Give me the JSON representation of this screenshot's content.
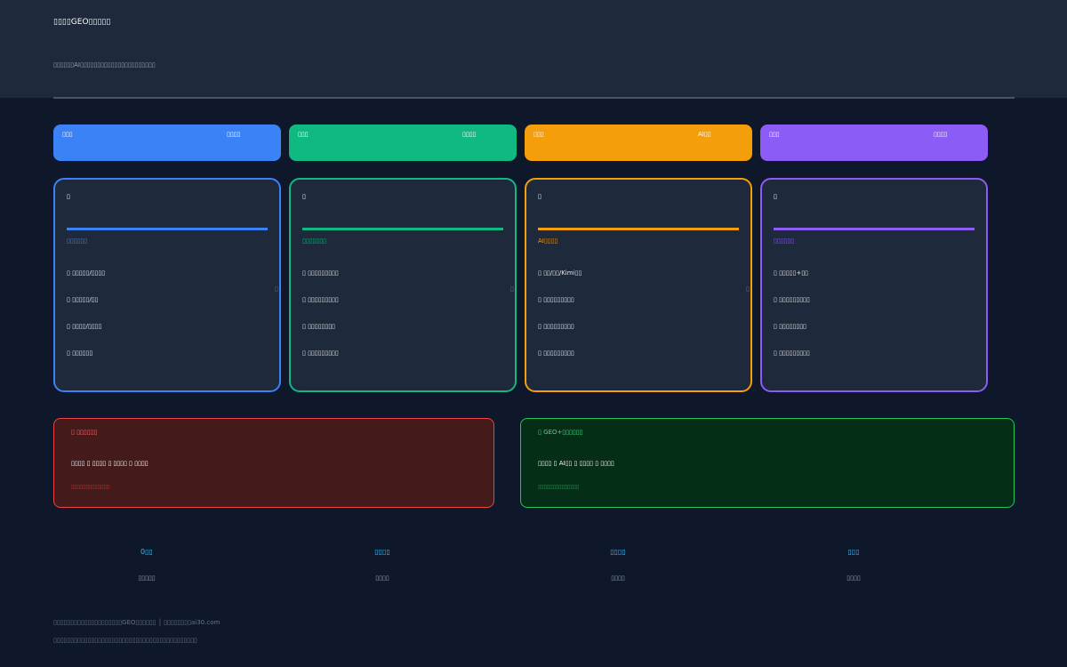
{
  "header": {
    "title": "▯▯▯▯GEO▯▯▯▯▯",
    "subtitle": "▯▯▯▯▯▯AI▯▯▯▯▯▯▯▯▯▯▯▯▯▯▯▯▯▯▯▯▯▯"
  },
  "steps": [
    {
      "num": "▯▯▯",
      "name": "▯▯▯▯",
      "color": "#3b82f6"
    },
    {
      "num": "▯▯▯",
      "name": "▯▯▯▯",
      "color": "#10b981"
    },
    {
      "num": "▯▯▯",
      "name": "AI▯▯",
      "color": "#f59e0b"
    },
    {
      "num": "▯▯▯",
      "name": "▯▯▯▯",
      "color": "#8b5cf6"
    }
  ],
  "cards": [
    {
      "icon": "▯",
      "heading": "▯▯▯▯▯▯",
      "items": [
        "▯ ▯▯▯▯▯/▯▯▯▯",
        "▯ ▯▯▯▯▯/▯▯",
        "▯ ▯▯▯▯/▯▯▯▯",
        "▯ ▯▯▯▯▯▯"
      ]
    },
    {
      "icon": "▯",
      "heading": "▯▯▯▯▯▯▯",
      "items": [
        "▯ ▯▯▯▯▯▯▯▯▯",
        "▯ ▯▯▯▯▯▯▯▯▯",
        "▯ ▯▯▯▯▯▯▯▯",
        "▯ ▯▯▯▯▯▯▯▯▯"
      ]
    },
    {
      "icon": "▯",
      "heading": "AI▯▯▯▯",
      "items": [
        "▯ ▯▯/▯▯/Kimi▯▯",
        "▯ ▯▯▯▯▯▯▯▯▯",
        "▯ ▯▯▯▯▯▯▯▯▯",
        "▯ ▯▯▯▯▯▯▯▯▯"
      ]
    },
    {
      "icon": "▯",
      "heading": "▯▯▯▯▯▯",
      "items": [
        "▯ ▯▯▯▯▯+▯▯",
        "▯ ▯▯▯▯▯▯▯▯▯",
        "▯ ▯▯▯▯▯▯▯▯",
        "▯ ▯▯▯▯▯▯▯▯▯"
      ]
    }
  ],
  "arrow_glyph": "▯",
  "comparison": {
    "bad": {
      "title": "▯  ▯▯▯▯▯▯",
      "flow": "▯▯▯▯ ▯ ▯▯▯▯ ▯ ▯▯▯▯ ▯ ▯▯▯▯",
      "note": "▯▯▯▯▯▯▯▯▯▯▯▯▯",
      "color": "#ef4444"
    },
    "good": {
      "title": "▯  GEO+▯▯▯▯▯▯",
      "flow": "▯▯▯▯ ▯ AI▯▯ ▯ ▯▯▯▯ ▯ ▯▯▯▯",
      "note": "▯▯▯▯▯▯▯▯▯▯▯▯▯▯",
      "color": "#22c55e"
    }
  },
  "stats": [
    {
      "value": "0▯▯",
      "label": "▯▯▯▯▯"
    },
    {
      "value": "▯▯▯▯",
      "label": "▯▯▯▯"
    },
    {
      "value": "▯▯▯▯",
      "label": "▯▯▯▯"
    },
    {
      "value": "▯▯▯",
      "label": "▯▯▯▯"
    }
  ],
  "footer": {
    "line1": "▯▯▯▯▯▯▯▯▯▯▯▯▯▯▯▯▯▯▯▯GEO▯▯▯▯▯▯ │ ▯▯▯▯▯▯▯▯ai30.com",
    "line2": "▯▯▯▯▯▯▯▯▯▯▯▯▯▯▯▯▯▯▯▯▯▯▯▯▯▯▯▯▯▯▯▯▯▯▯▯▯▯▯▯▯▯"
  }
}
